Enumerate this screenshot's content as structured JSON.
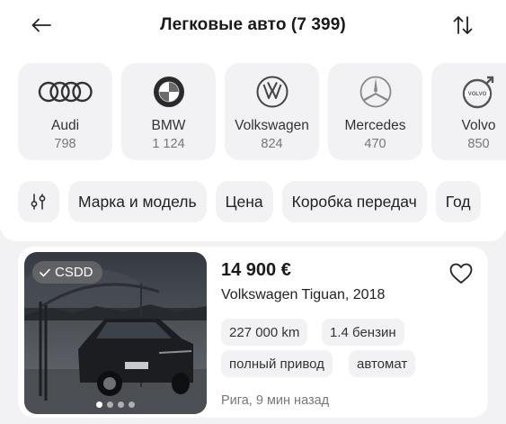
{
  "header": {
    "title": "Легковые авто (7 399)",
    "back_icon": "arrow-left-icon",
    "sort_icon": "sort-arrows-icon"
  },
  "brands": [
    {
      "name": "Audi",
      "count": "798",
      "icon": "audi-logo"
    },
    {
      "name": "BMW",
      "count": "1 124",
      "icon": "bmw-logo"
    },
    {
      "name": "Volkswagen",
      "count": "824",
      "icon": "volkswagen-logo"
    },
    {
      "name": "Mercedes",
      "count": "470",
      "icon": "mercedes-logo"
    },
    {
      "name": "Volvo",
      "count": "850",
      "icon": "volvo-logo"
    }
  ],
  "filters": {
    "settings_icon": "sliders-icon",
    "chips": [
      "Марка и модель",
      "Цена",
      "Коробка передач",
      "Год"
    ]
  },
  "listing": {
    "badge": "CSDD",
    "badge_icon": "check-icon",
    "price": "14 900 €",
    "title": "Volkswagen Tiguan, 2018",
    "tags": [
      "227 000 km",
      "1.4 бензин",
      "полный привод",
      "автомат"
    ],
    "location": "Рига, 9 мин назад",
    "photo_count": 4,
    "active_photo": 1,
    "favorite_icon": "heart-outline-icon"
  },
  "colors": {
    "background": "#f2f2f4",
    "surface": "#ffffff",
    "chip": "#f2f2f4",
    "text": "#1a1a1a",
    "muted": "#777777"
  }
}
